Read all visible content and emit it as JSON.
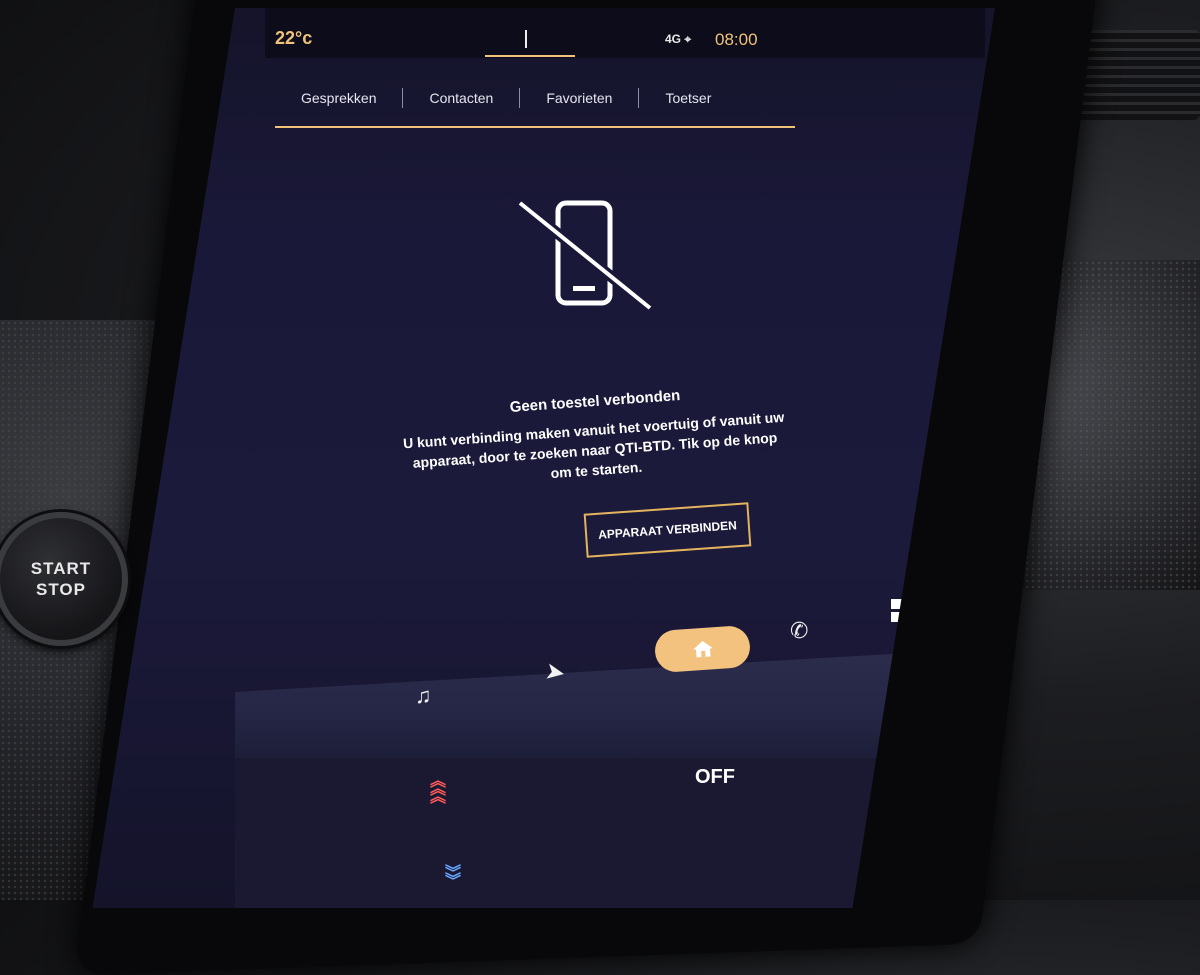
{
  "status": {
    "temperature": "22°c",
    "signal": "4G",
    "time": "08:00"
  },
  "tabs": [
    {
      "label": "Gesprekken"
    },
    {
      "label": "Contacten"
    },
    {
      "label": "Favorieten"
    },
    {
      "label": "Toetser"
    }
  ],
  "message": {
    "title": "Geen toestel verbonden",
    "body_line1": "U kunt verbinding maken vanuit het voertuig of vanuit uw",
    "body_line2": "apparaat, door te zoeken naar QTI-BTD. Tik op de knop",
    "body_line3": "om te starten.",
    "button": "APPARAAT VERBINDEN"
  },
  "climate": {
    "fan_label": "OFF"
  },
  "dashboard": {
    "start_line1": "START",
    "start_line2": "STOP"
  },
  "colors": {
    "accent": "#f0c27a",
    "heat": "#ff5a5a",
    "cool": "#6aa8ff"
  }
}
